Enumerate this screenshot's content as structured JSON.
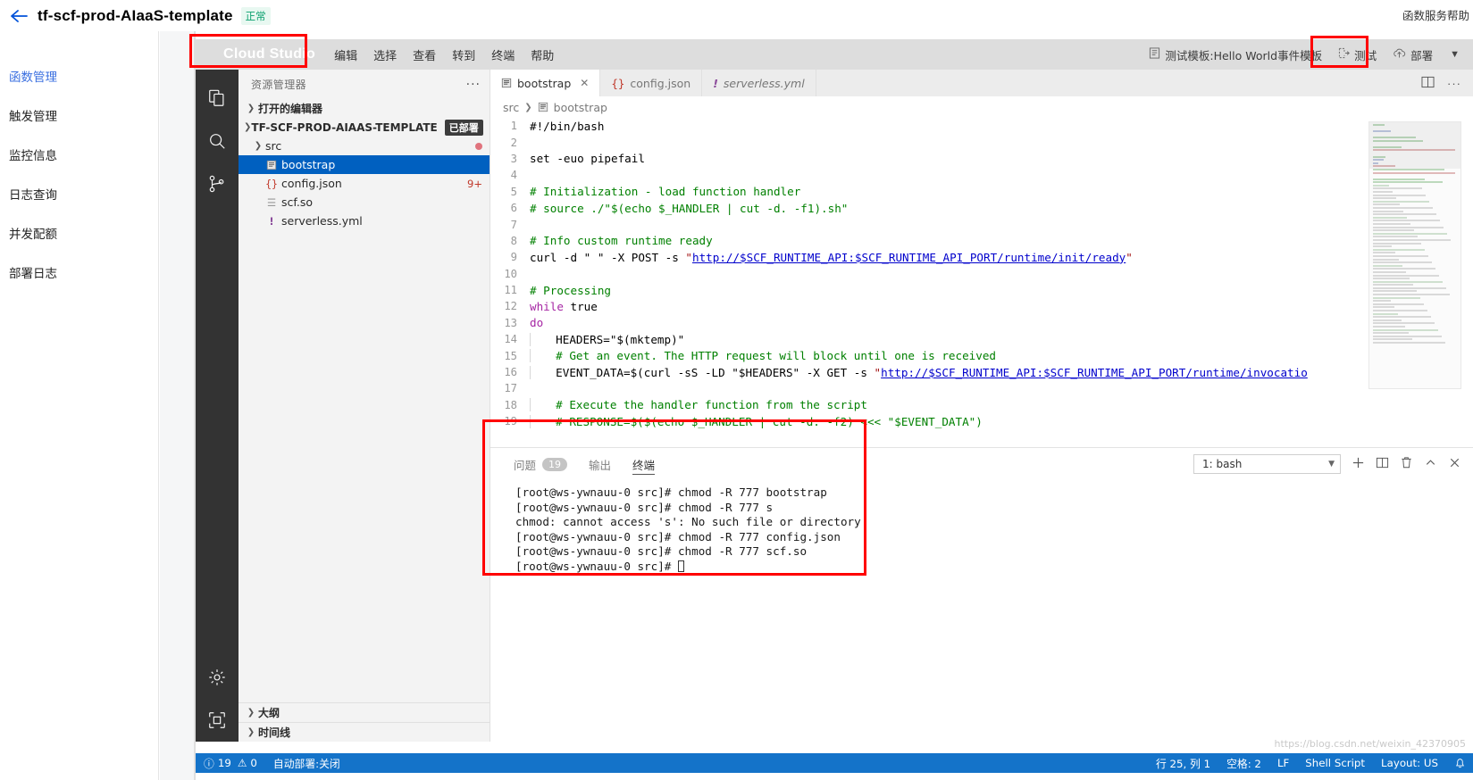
{
  "console": {
    "back_icon": "back-arrow-icon",
    "title": "tf-scf-prod-AIaaS-template",
    "status": "正常",
    "header_right": "函数服务帮助",
    "nav": [
      {
        "label": "函数管理",
        "active": true
      },
      {
        "label": "触发管理",
        "active": false
      },
      {
        "label": "监控信息",
        "active": false
      },
      {
        "label": "日志查询",
        "active": false
      },
      {
        "label": "并发配额",
        "active": false
      },
      {
        "label": "部署日志",
        "active": false
      }
    ]
  },
  "ide": {
    "brand": "Cloud Studio",
    "menus": [
      "编辑",
      "选择",
      "查看",
      "转到",
      "终端",
      "帮助"
    ],
    "toolbar": {
      "template_label": "测试模板:Hello World事件模板",
      "test_label": "测试",
      "deploy_label": "部署",
      "caret": "▼"
    },
    "activitybar": [
      {
        "name": "explorer-icon"
      },
      {
        "name": "search-icon"
      },
      {
        "name": "source-control-icon"
      },
      {
        "name": "settings-gear-icon"
      },
      {
        "name": "remote-explorer-icon"
      }
    ],
    "explorer": {
      "title": "资源管理器",
      "more": "···",
      "open_editors": "打开的编辑器",
      "project": "TF-SCF-PROD-AIAAS-TEMPLATE",
      "project_badge": "已部署",
      "folder": "src",
      "files": [
        {
          "name": "bootstrap",
          "icon": "shell-file-icon",
          "selected": true,
          "badge": ""
        },
        {
          "name": "config.json",
          "icon": "json-file-icon",
          "selected": false,
          "badge": "9+"
        },
        {
          "name": "scf.so",
          "icon": "binary-file-icon",
          "selected": false,
          "badge": ""
        },
        {
          "name": "serverless.yml",
          "icon": "yaml-file-icon",
          "selected": false,
          "badge": ""
        }
      ],
      "bottom_sections": [
        "大纲",
        "时间线"
      ]
    },
    "tabs": [
      {
        "label": "bootstrap",
        "icon": "shell-file-icon",
        "active": true,
        "closable": true,
        "italic": false
      },
      {
        "label": "config.json",
        "icon": "json-file-icon",
        "active": false,
        "closable": false,
        "italic": false
      },
      {
        "label": "serverless.yml",
        "icon": "yaml-file-icon",
        "active": false,
        "closable": false,
        "italic": true
      }
    ],
    "tab_actions": [
      "split-editor-icon",
      "more-actions-icon"
    ],
    "breadcrumb": [
      "src",
      "bootstrap"
    ],
    "code": [
      {
        "n": 1,
        "segs": [
          {
            "t": "#!/bin/bash",
            "c": "ctext"
          }
        ]
      },
      {
        "n": 2,
        "segs": []
      },
      {
        "n": 3,
        "segs": [
          {
            "t": "set",
            "c": "ctext"
          },
          {
            "t": " -euo ",
            "c": "ctext"
          },
          {
            "t": "pipefail",
            "c": "ctext"
          }
        ]
      },
      {
        "n": 4,
        "segs": []
      },
      {
        "n": 5,
        "segs": [
          {
            "t": "# Initialization - load function handler",
            "c": "cm"
          }
        ]
      },
      {
        "n": 6,
        "segs": [
          {
            "t": "# source ./\"$(echo $_HANDLER | cut -d. -f1).sh\"",
            "c": "cm"
          }
        ]
      },
      {
        "n": 7,
        "segs": []
      },
      {
        "n": 8,
        "segs": [
          {
            "t": "# Info custom runtime ready",
            "c": "cm"
          }
        ]
      },
      {
        "n": 9,
        "segs": [
          {
            "t": "curl -d \" \" -X POST -s ",
            "c": "ctext"
          },
          {
            "t": "\"",
            "c": "str"
          },
          {
            "t": "http://$SCF_RUNTIME_API:$SCF_RUNTIME_API_PORT/runtime/init/ready",
            "c": "url"
          },
          {
            "t": "\"",
            "c": "str"
          }
        ]
      },
      {
        "n": 10,
        "segs": []
      },
      {
        "n": 11,
        "segs": [
          {
            "t": "# Processing",
            "c": "cm"
          }
        ]
      },
      {
        "n": 12,
        "segs": [
          {
            "t": "while",
            "c": "kw"
          },
          {
            "t": " true",
            "c": "ctext"
          }
        ]
      },
      {
        "n": 13,
        "segs": [
          {
            "t": "do",
            "c": "kw"
          }
        ]
      },
      {
        "n": 14,
        "segs": [
          {
            "t": "  HEADERS=",
            "c": "ctext"
          },
          {
            "t": "\"$(mktemp)\"",
            "c": "ctext"
          }
        ]
      },
      {
        "n": 15,
        "segs": [
          {
            "t": "  # Get an event. The HTTP request will block until one is received",
            "c": "cm"
          }
        ]
      },
      {
        "n": 16,
        "segs": [
          {
            "t": "  EVENT_DATA=$(curl -sS -LD \"$HEADERS\" -X GET -s ",
            "c": "ctext"
          },
          {
            "t": "\"",
            "c": "str"
          },
          {
            "t": "http://$SCF_RUNTIME_API:$SCF_RUNTIME_API_PORT/runtime/invocatio",
            "c": "url"
          }
        ]
      },
      {
        "n": 17,
        "segs": []
      },
      {
        "n": 18,
        "segs": [
          {
            "t": "  # Execute the handler function from the script",
            "c": "cm"
          }
        ]
      },
      {
        "n": 19,
        "segs": [
          {
            "t": "  # RESPONSE=$($(echo $_HANDLER | cut -d. -f2) <<< \"$EVENT_DATA\")",
            "c": "cm"
          }
        ]
      }
    ],
    "panel": {
      "tabs": [
        {
          "label": "问题",
          "badge": "19",
          "active": false
        },
        {
          "label": "输出",
          "badge": "",
          "active": false
        },
        {
          "label": "终端",
          "badge": "",
          "active": true
        }
      ],
      "terminal_select": "1: bash",
      "actions": [
        "new-terminal-icon",
        "split-terminal-icon",
        "kill-terminal-icon",
        "maximize-panel-icon",
        "close-panel-icon"
      ],
      "lines": [
        "[root@ws-ywnauu-0 src]# chmod -R 777 bootstrap",
        "[root@ws-ywnauu-0 src]# chmod -R 777 s",
        "chmod: cannot access 's': No such file or directory",
        "[root@ws-ywnauu-0 src]# chmod -R 777 config.json",
        "[root@ws-ywnauu-0 src]# chmod -R 777 scf.so",
        "[root@ws-ywnauu-0 src]# "
      ]
    },
    "statusbar": {
      "errors": "19",
      "warnings": "0",
      "autodeploy": "自动部署:关闭",
      "position": "行 25, 列 1",
      "indent": "空格: 2",
      "eol": "LF",
      "language": "Shell Script",
      "layout": "Layout: US",
      "bell": "bell-icon"
    }
  },
  "watermark": "https://blog.csdn.net/weixin_42370905"
}
